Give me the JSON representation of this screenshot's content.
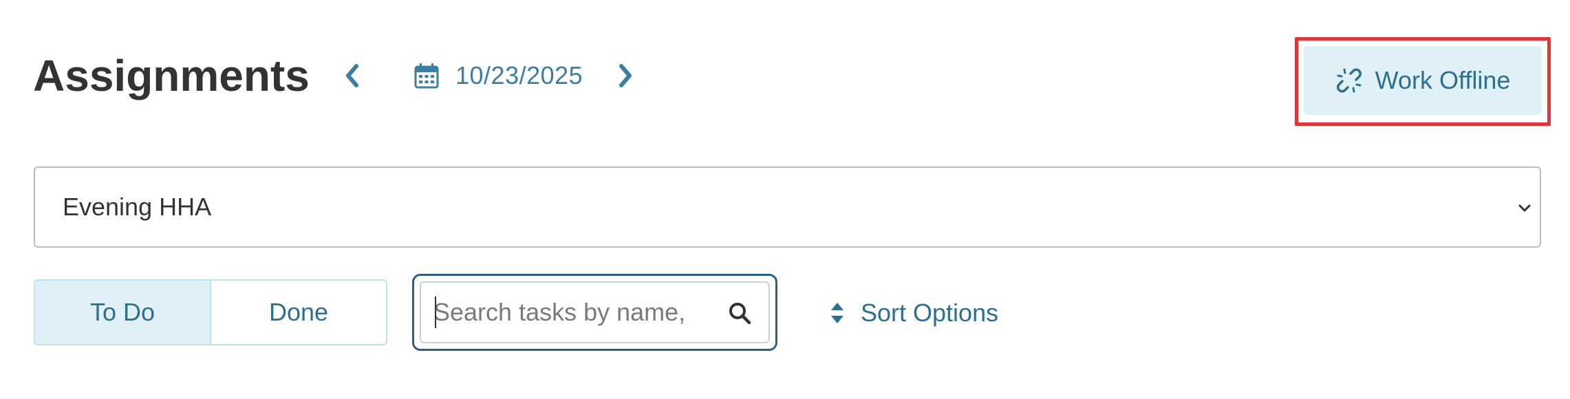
{
  "header": {
    "title": "Assignments",
    "date": "10/23/2025",
    "prev_icon": "chevron-left-icon",
    "next_icon": "chevron-right-icon",
    "calendar_icon": "calendar-icon"
  },
  "offline": {
    "label": "Work Offline",
    "icon": "unlink-icon",
    "highlight_color": "#e0333a"
  },
  "select": {
    "value": "Evening HHA",
    "icon": "chevron-down-icon"
  },
  "filter": {
    "tabs": [
      {
        "label": "To Do",
        "active": true
      },
      {
        "label": "Done",
        "active": false
      }
    ]
  },
  "search": {
    "value": "",
    "placeholder": "Search tasks by name, ",
    "icon": "search-icon"
  },
  "sort": {
    "label": "Sort Options",
    "icon": "sort-icon"
  },
  "colors": {
    "accent": "#3b7ea2",
    "accent_dark": "#2f6f8e",
    "button_bg": "#dff1f6",
    "title": "#333333",
    "focus_border": "#2c5d84"
  }
}
